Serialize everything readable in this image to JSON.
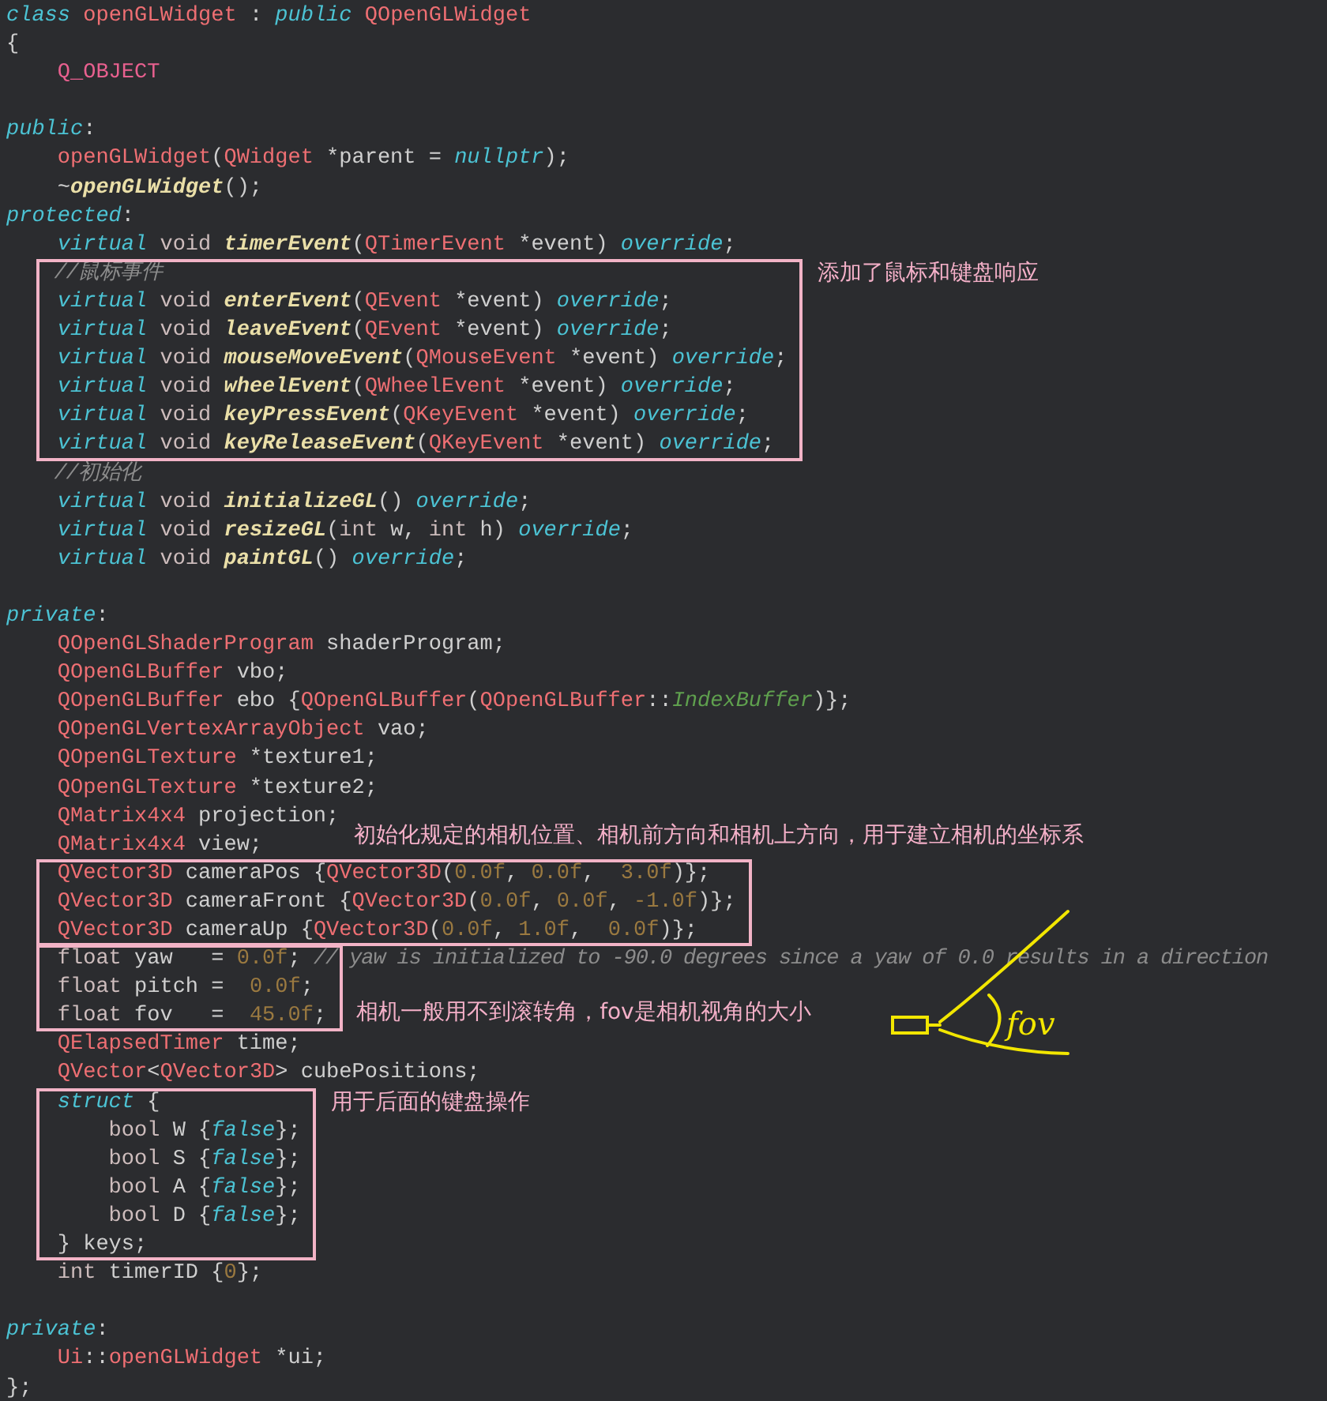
{
  "editor": {
    "sections": [
      {
        "framed": false,
        "lines": [
          {
            "kind": "code",
            "tokens": [
              {
                "kind": "kw",
                "text": "class"
              },
              {
                "kind": "type",
                "text": " openGLWidget"
              },
              {
                "kind": "plain",
                "text": " : "
              },
              {
                "kind": "kw",
                "text": "public"
              },
              {
                "kind": "type",
                "text": " QOpenGLWidget"
              }
            ]
          },
          {
            "kind": "code",
            "tokens": [
              {
                "kind": "plain",
                "text": "{"
              }
            ]
          },
          {
            "kind": "code",
            "tokens": [
              {
                "kind": "macro",
                "text": "    Q_OBJECT"
              }
            ]
          },
          {
            "kind": "blank"
          },
          {
            "kind": "code",
            "tokens": [
              {
                "kind": "kw",
                "text": "public"
              },
              {
                "kind": "plain",
                "text": ":"
              }
            ]
          },
          {
            "kind": "code",
            "tokens": [
              {
                "kind": "type",
                "text": "    openGLWidget"
              },
              {
                "kind": "plain",
                "text": "("
              },
              {
                "kind": "type",
                "text": "QWidget"
              },
              {
                "kind": "plain",
                "text": " *parent = "
              },
              {
                "kind": "kw",
                "text": "nullptr"
              },
              {
                "kind": "plain",
                "text": ");"
              }
            ]
          },
          {
            "kind": "code",
            "tokens": [
              {
                "kind": "plain",
                "text": "    ~"
              },
              {
                "kind": "fn",
                "text": "openGLWidget"
              },
              {
                "kind": "plain",
                "text": "();"
              }
            ]
          },
          {
            "kind": "code",
            "tokens": [
              {
                "kind": "kw",
                "text": "protected"
              },
              {
                "kind": "plain",
                "text": ":"
              }
            ]
          },
          {
            "kind": "code",
            "tokens": [
              {
                "kind": "kw",
                "text": "    virtual"
              },
              {
                "kind": "prim",
                "text": " void"
              },
              {
                "kind": "fn",
                "text": " timerEvent"
              },
              {
                "kind": "plain",
                "text": "("
              },
              {
                "kind": "type",
                "text": "QTimerEvent"
              },
              {
                "kind": "plain",
                "text": " *event) "
              },
              {
                "kind": "kw",
                "text": "override"
              },
              {
                "kind": "plain",
                "text": ";"
              }
            ]
          }
        ]
      },
      {
        "framed": true,
        "note": {
          "text": "添加了鼠标和键盘响应",
          "kind": "right-top"
        },
        "lines": [
          {
            "kind": "code",
            "tokens": [
              {
                "kind": "cmt",
                "text": "    //鼠标事件"
              }
            ]
          },
          {
            "kind": "code",
            "tokens": [
              {
                "kind": "kw",
                "text": "    virtual"
              },
              {
                "kind": "prim",
                "text": " void"
              },
              {
                "kind": "fn",
                "text": " enterEvent"
              },
              {
                "kind": "plain",
                "text": "("
              },
              {
                "kind": "type",
                "text": "QEvent"
              },
              {
                "kind": "plain",
                "text": " *event) "
              },
              {
                "kind": "kw",
                "text": "override"
              },
              {
                "kind": "plain",
                "text": ";"
              }
            ]
          },
          {
            "kind": "code",
            "tokens": [
              {
                "kind": "kw",
                "text": "    virtual"
              },
              {
                "kind": "prim",
                "text": " void"
              },
              {
                "kind": "fn",
                "text": " leaveEvent"
              },
              {
                "kind": "plain",
                "text": "("
              },
              {
                "kind": "type",
                "text": "QEvent"
              },
              {
                "kind": "plain",
                "text": " *event) "
              },
              {
                "kind": "kw",
                "text": "override"
              },
              {
                "kind": "plain",
                "text": ";"
              }
            ]
          },
          {
            "kind": "code",
            "tokens": [
              {
                "kind": "kw",
                "text": "    virtual"
              },
              {
                "kind": "prim",
                "text": " void"
              },
              {
                "kind": "fn",
                "text": " mouseMoveEvent"
              },
              {
                "kind": "plain",
                "text": "("
              },
              {
                "kind": "type",
                "text": "QMouseEvent"
              },
              {
                "kind": "plain",
                "text": " *event) "
              },
              {
                "kind": "kw",
                "text": "override"
              },
              {
                "kind": "plain",
                "text": ";"
              }
            ]
          },
          {
            "kind": "code",
            "tokens": [
              {
                "kind": "kw",
                "text": "    virtual"
              },
              {
                "kind": "prim",
                "text": " void"
              },
              {
                "kind": "fn",
                "text": " wheelEvent"
              },
              {
                "kind": "plain",
                "text": "("
              },
              {
                "kind": "type",
                "text": "QWheelEvent"
              },
              {
                "kind": "plain",
                "text": " *event) "
              },
              {
                "kind": "kw",
                "text": "override"
              },
              {
                "kind": "plain",
                "text": ";"
              }
            ]
          },
          {
            "kind": "code",
            "tokens": [
              {
                "kind": "kw",
                "text": "    virtual"
              },
              {
                "kind": "prim",
                "text": " void"
              },
              {
                "kind": "fn",
                "text": " keyPressEvent"
              },
              {
                "kind": "plain",
                "text": "("
              },
              {
                "kind": "type",
                "text": "QKeyEvent"
              },
              {
                "kind": "plain",
                "text": " *event) "
              },
              {
                "kind": "kw",
                "text": "override"
              },
              {
                "kind": "plain",
                "text": ";"
              }
            ]
          },
          {
            "kind": "code",
            "tokens": [
              {
                "kind": "kw",
                "text": "    virtual"
              },
              {
                "kind": "prim",
                "text": " void"
              },
              {
                "kind": "fn",
                "text": " keyReleaseEvent"
              },
              {
                "kind": "plain",
                "text": "("
              },
              {
                "kind": "type",
                "text": "QKeyEvent"
              },
              {
                "kind": "plain",
                "text": " *event) "
              },
              {
                "kind": "kw",
                "text": "override"
              },
              {
                "kind": "plain",
                "text": ";"
              }
            ]
          }
        ]
      },
      {
        "framed": false,
        "lines": [
          {
            "kind": "code",
            "tokens": [
              {
                "kind": "cmt",
                "text": "    //初始化"
              }
            ]
          },
          {
            "kind": "code",
            "tokens": [
              {
                "kind": "kw",
                "text": "    virtual"
              },
              {
                "kind": "prim",
                "text": " void"
              },
              {
                "kind": "fn",
                "text": " initializeGL"
              },
              {
                "kind": "plain",
                "text": "() "
              },
              {
                "kind": "kw",
                "text": "override"
              },
              {
                "kind": "plain",
                "text": ";"
              }
            ]
          },
          {
            "kind": "code",
            "tokens": [
              {
                "kind": "kw",
                "text": "    virtual"
              },
              {
                "kind": "prim",
                "text": " void"
              },
              {
                "kind": "fn",
                "text": " resizeGL"
              },
              {
                "kind": "plain",
                "text": "("
              },
              {
                "kind": "prim",
                "text": "int"
              },
              {
                "kind": "plain",
                "text": " w, "
              },
              {
                "kind": "prim",
                "text": "int"
              },
              {
                "kind": "plain",
                "text": " h) "
              },
              {
                "kind": "kw",
                "text": "override"
              },
              {
                "kind": "plain",
                "text": ";"
              }
            ]
          },
          {
            "kind": "code",
            "tokens": [
              {
                "kind": "kw",
                "text": "    virtual"
              },
              {
                "kind": "prim",
                "text": " void"
              },
              {
                "kind": "fn",
                "text": " paintGL"
              },
              {
                "kind": "plain",
                "text": "() "
              },
              {
                "kind": "kw",
                "text": "override"
              },
              {
                "kind": "plain",
                "text": ";"
              }
            ]
          },
          {
            "kind": "blank"
          },
          {
            "kind": "code",
            "tokens": [
              {
                "kind": "kw",
                "text": "private"
              },
              {
                "kind": "plain",
                "text": ":"
              }
            ]
          },
          {
            "kind": "code",
            "tokens": [
              {
                "kind": "type",
                "text": "    QOpenGLShaderProgram"
              },
              {
                "kind": "plain",
                "text": " shaderProgram;"
              }
            ]
          },
          {
            "kind": "code",
            "tokens": [
              {
                "kind": "type",
                "text": "    QOpenGLBuffer"
              },
              {
                "kind": "plain",
                "text": " vbo;"
              }
            ]
          },
          {
            "kind": "code",
            "tokens": [
              {
                "kind": "type",
                "text": "    QOpenGLBuffer"
              },
              {
                "kind": "plain",
                "text": " ebo {"
              },
              {
                "kind": "type",
                "text": "QOpenGLBuffer"
              },
              {
                "kind": "plain",
                "text": "("
              },
              {
                "kind": "type",
                "text": "QOpenGLBuffer"
              },
              {
                "kind": "plain",
                "text": "::"
              },
              {
                "kind": "enum",
                "text": "IndexBuffer"
              },
              {
                "kind": "plain",
                "text": ")};"
              }
            ]
          },
          {
            "kind": "code",
            "tokens": [
              {
                "kind": "type",
                "text": "    QOpenGLVertexArrayObject"
              },
              {
                "kind": "plain",
                "text": " vao;"
              }
            ]
          },
          {
            "kind": "code",
            "tokens": [
              {
                "kind": "type",
                "text": "    QOpenGLTexture"
              },
              {
                "kind": "plain",
                "text": " *texture1;"
              }
            ]
          },
          {
            "kind": "code",
            "tokens": [
              {
                "kind": "type",
                "text": "    QOpenGLTexture"
              },
              {
                "kind": "plain",
                "text": " *texture2;"
              }
            ]
          },
          {
            "kind": "code",
            "tokens": [
              {
                "kind": "type",
                "text": "    QMatrix4x4"
              },
              {
                "kind": "plain",
                "text": " projection;"
              }
            ]
          },
          {
            "kind": "code",
            "tokens": [
              {
                "kind": "type",
                "text": "    QMatrix4x4"
              },
              {
                "kind": "plain",
                "text": " view;"
              }
            ]
          }
        ]
      },
      {
        "framed": true,
        "note": {
          "text": "初始化规定的相机位置、相机前方向和相机上方向，用于建立相机的坐标系",
          "kind": "above"
        },
        "lines": [
          {
            "kind": "code",
            "tokens": [
              {
                "kind": "type",
                "text": "    QVector3D"
              },
              {
                "kind": "plain",
                "text": " cameraPos {"
              },
              {
                "kind": "type",
                "text": "QVector3D"
              },
              {
                "kind": "plain",
                "text": "("
              },
              {
                "kind": "num",
                "text": "0.0f"
              },
              {
                "kind": "plain",
                "text": ", "
              },
              {
                "kind": "num",
                "text": "0.0f"
              },
              {
                "kind": "plain",
                "text": ",  "
              },
              {
                "kind": "num",
                "text": "3.0f"
              },
              {
                "kind": "plain",
                "text": ")};"
              }
            ]
          },
          {
            "kind": "code",
            "tokens": [
              {
                "kind": "type",
                "text": "    QVector3D"
              },
              {
                "kind": "plain",
                "text": " cameraFront {"
              },
              {
                "kind": "type",
                "text": "QVector3D"
              },
              {
                "kind": "plain",
                "text": "("
              },
              {
                "kind": "num",
                "text": "0.0f"
              },
              {
                "kind": "plain",
                "text": ", "
              },
              {
                "kind": "num",
                "text": "0.0f"
              },
              {
                "kind": "plain",
                "text": ", "
              },
              {
                "kind": "num",
                "text": "-1.0f"
              },
              {
                "kind": "plain",
                "text": ")};"
              }
            ]
          },
          {
            "kind": "code",
            "tokens": [
              {
                "kind": "type",
                "text": "    QVector3D"
              },
              {
                "kind": "plain",
                "text": " cameraUp {"
              },
              {
                "kind": "type",
                "text": "QVector3D"
              },
              {
                "kind": "plain",
                "text": "("
              },
              {
                "kind": "num",
                "text": "0.0f"
              },
              {
                "kind": "plain",
                "text": ", "
              },
              {
                "kind": "num",
                "text": "1.0f"
              },
              {
                "kind": "plain",
                "text": ",  "
              },
              {
                "kind": "num",
                "text": "0.0f"
              },
              {
                "kind": "plain",
                "text": ")};"
              }
            ]
          }
        ]
      },
      {
        "framed": true,
        "note": {
          "text": "相机一般用不到滚转角，fov是相机视角的大小",
          "kind": "right-bottom"
        },
        "lines": [
          {
            "kind": "code",
            "tokens": [
              {
                "kind": "prim",
                "text": "    float"
              },
              {
                "kind": "plain",
                "text": " yaw   = "
              },
              {
                "kind": "num",
                "text": "0.0f"
              },
              {
                "kind": "plain",
                "text": "; "
              },
              {
                "kind": "cmt",
                "text": "// yaw is initialized to -90.0 degrees since a yaw of 0.0 results in a direction"
              }
            ]
          },
          {
            "kind": "code",
            "tokens": [
              {
                "kind": "prim",
                "text": "    float"
              },
              {
                "kind": "plain",
                "text": " pitch =  "
              },
              {
                "kind": "num",
                "text": "0.0f"
              },
              {
                "kind": "plain",
                "text": ";"
              }
            ]
          },
          {
            "kind": "code",
            "tokens": [
              {
                "kind": "prim",
                "text": "    float"
              },
              {
                "kind": "plain",
                "text": " fov   =  "
              },
              {
                "kind": "num",
                "text": "45.0f"
              },
              {
                "kind": "plain",
                "text": ";"
              }
            ]
          }
        ]
      },
      {
        "framed": false,
        "lines": [
          {
            "kind": "code",
            "tokens": [
              {
                "kind": "type",
                "text": "    QElapsedTimer"
              },
              {
                "kind": "plain",
                "text": " time;"
              }
            ]
          },
          {
            "kind": "code",
            "tokens": [
              {
                "kind": "type",
                "text": "    QVector"
              },
              {
                "kind": "plain",
                "text": "<"
              },
              {
                "kind": "type",
                "text": "QVector3D"
              },
              {
                "kind": "plain",
                "text": "> cubePositions;"
              }
            ]
          }
        ]
      },
      {
        "framed": true,
        "note": {
          "text": "用于后面的键盘操作",
          "kind": "right-top"
        },
        "lines": [
          {
            "kind": "code",
            "tokens": [
              {
                "kind": "kw",
                "text": "    struct"
              },
              {
                "kind": "plain",
                "text": " {"
              }
            ]
          },
          {
            "kind": "code",
            "tokens": [
              {
                "kind": "prim",
                "text": "        bool"
              },
              {
                "kind": "plain",
                "text": " W {"
              },
              {
                "kind": "kw",
                "text": "false"
              },
              {
                "kind": "plain",
                "text": "};"
              }
            ]
          },
          {
            "kind": "code",
            "tokens": [
              {
                "kind": "prim",
                "text": "        bool"
              },
              {
                "kind": "plain",
                "text": " S {"
              },
              {
                "kind": "kw",
                "text": "false"
              },
              {
                "kind": "plain",
                "text": "};"
              }
            ]
          },
          {
            "kind": "code",
            "tokens": [
              {
                "kind": "prim",
                "text": "        bool"
              },
              {
                "kind": "plain",
                "text": " A {"
              },
              {
                "kind": "kw",
                "text": "false"
              },
              {
                "kind": "plain",
                "text": "};"
              }
            ]
          },
          {
            "kind": "code",
            "tokens": [
              {
                "kind": "prim",
                "text": "        bool"
              },
              {
                "kind": "plain",
                "text": " D {"
              },
              {
                "kind": "kw",
                "text": "false"
              },
              {
                "kind": "plain",
                "text": "};"
              }
            ]
          },
          {
            "kind": "code",
            "tokens": [
              {
                "kind": "plain",
                "text": "    } keys;"
              }
            ]
          }
        ]
      },
      {
        "framed": false,
        "lines": [
          {
            "kind": "code",
            "tokens": [
              {
                "kind": "prim",
                "text": "    int"
              },
              {
                "kind": "plain",
                "text": " timerID {"
              },
              {
                "kind": "num",
                "text": "0"
              },
              {
                "kind": "plain",
                "text": "};"
              }
            ]
          },
          {
            "kind": "blank"
          },
          {
            "kind": "code",
            "tokens": [
              {
                "kind": "kw",
                "text": "private"
              },
              {
                "kind": "plain",
                "text": ":"
              }
            ]
          },
          {
            "kind": "code",
            "tokens": [
              {
                "kind": "type",
                "text": "    Ui"
              },
              {
                "kind": "plain",
                "text": "::"
              },
              {
                "kind": "type",
                "text": "openGLWidget"
              },
              {
                "kind": "plain",
                "text": " *ui;"
              }
            ]
          },
          {
            "kind": "code",
            "tokens": [
              {
                "kind": "plain",
                "text": "};"
              }
            ]
          }
        ]
      }
    ]
  },
  "sketch": {
    "label": "fov"
  }
}
